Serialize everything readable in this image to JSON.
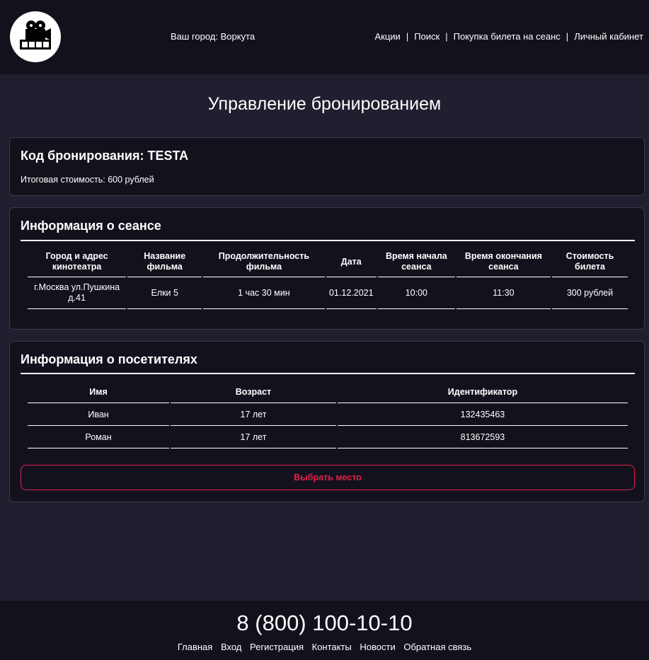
{
  "header": {
    "city": "Ваш город: Воркута",
    "nav": [
      "Акции",
      "Поиск",
      "Покупка билета на сеанс",
      "Личный кабинет"
    ],
    "nav_separator": "|"
  },
  "page_title": "Управление бронированием",
  "booking": {
    "code": "Код бронирования: TESTA",
    "total": "Итоговая стоимость: 600 рублей"
  },
  "session": {
    "title": "Информация о сеансе",
    "headers": [
      "Город и адрес кинотеатра",
      "Название фильма",
      "Продолжительность фильма",
      "Дата",
      "Время начала сеанса",
      "Время окончания сеанса",
      "Стоимость билета"
    ],
    "row": [
      "г.Москва ул.Пушкина д.41",
      "Елки 5",
      "1 час 30 мин",
      "01.12.2021",
      "10:00",
      "11:30",
      "300 рублей"
    ]
  },
  "visitors": {
    "title": "Информация о посетителях",
    "headers": [
      "Имя",
      "Возраст",
      "Идентификатор"
    ],
    "rows": [
      [
        "Иван",
        "17 лет",
        "132435463"
      ],
      [
        "Роман",
        "17 лет",
        "813672593"
      ]
    ],
    "choose_seat": "Выбрать место"
  },
  "footer": {
    "phone": "8 (800) 100-10-10",
    "links": [
      "Главная",
      "Вход",
      "Регистрация",
      "Контакты",
      "Новости",
      "Обратная связь"
    ]
  },
  "colors": {
    "header_bg": "#13121c",
    "page_bg": "#201f2f",
    "accent": "#e0214a"
  },
  "icons": {
    "logo": "film-camera-icon"
  }
}
